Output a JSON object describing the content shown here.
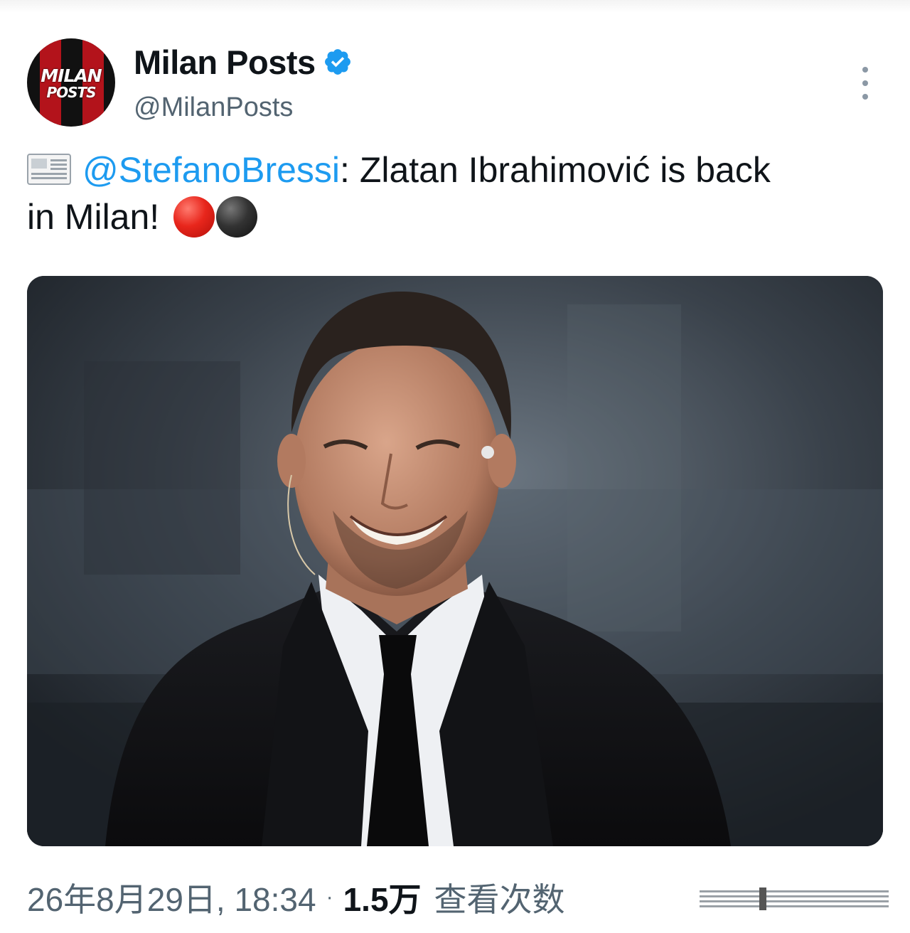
{
  "tweet": {
    "author": {
      "avatar_text_line1": "MILAN",
      "avatar_text_line2": "POSTS",
      "display_name": "Milan Posts",
      "handle": "@MilanPosts",
      "verified": true,
      "verified_icon": "verified-badge-icon",
      "verified_color": "#1d9bf0"
    },
    "more_icon": "more-vertical-icon",
    "text": {
      "leading_icon": "newspaper-icon",
      "mention": "@StefanoBressi",
      "body_line1": ": Zlatan Ibrahimović is back",
      "body_line2": "in Milan!",
      "trailing_icons": [
        "red-circle-icon",
        "black-circle-icon"
      ]
    },
    "media": {
      "type": "photo",
      "subject_icon": "smiling-man-in-suit-photo"
    },
    "meta": {
      "timestamp": "26年8月29日, 18:34",
      "separator": "·",
      "views_count": "1.5万",
      "views_label": "查看次数"
    }
  },
  "colors": {
    "link": "#1d9bf0",
    "secondary_text": "#536471",
    "primary_text": "#0f1419",
    "milan_red": "#b3131b"
  }
}
